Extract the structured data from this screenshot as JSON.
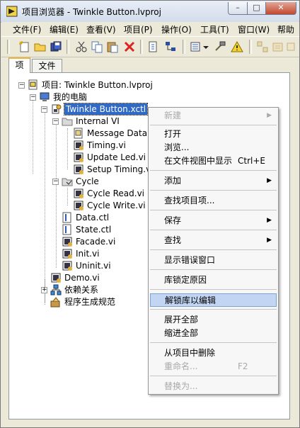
{
  "window": {
    "title": "项目浏览器 - Twinkle Button.lvproj",
    "controls": {
      "minimize": "–",
      "maximize": "□",
      "close": "✕"
    }
  },
  "menubar": {
    "items": [
      "文件(F)",
      "编辑(E)",
      "查看(V)",
      "项目(P)",
      "操作(O)",
      "工具(T)",
      "窗口(W)",
      "帮助"
    ]
  },
  "tabs": {
    "items": "项",
    "files": "文件"
  },
  "tree": {
    "project": "项目: Twinkle Button.lvproj",
    "my_computer": "我的电脑",
    "xctl": "Twinkle Button.xctl",
    "internal_vi": "Internal VI",
    "message_data": "Message Data.ctl",
    "timing": "Timing.vi",
    "update_led": "Update Led.vi",
    "setup_timing": "Setup Timing.vi",
    "cycle": "Cycle",
    "cycle_read": "Cycle Read.vi",
    "cycle_write": "Cycle Write.vi",
    "data_ctl": "Data.ctl",
    "state_ctl": "State.ctl",
    "facade": "Facade.vi",
    "init": "Init.vi",
    "uninit": "Uninit.vi",
    "demo": "Demo.vi",
    "dependencies": "依赖关系",
    "build_specs": "程序生成规范"
  },
  "context_menu": {
    "new": "新建",
    "open": "打开",
    "browse": "浏览...",
    "show_in_files": "在文件视图中显示",
    "show_in_files_shortcut": "Ctrl+E",
    "add": "添加",
    "find_project_items": "查找项目项...",
    "save": "保存",
    "find": "查找",
    "show_error": "显示错误窗口",
    "lock_reason": "库锁定原因",
    "unlock_to_edit": "解锁库以编辑",
    "expand_all": "展开全部",
    "collapse_all": "缩进全部",
    "remove_from_project": "从项目中删除",
    "rename": "重命名...",
    "rename_shortcut": "F2",
    "replace_with": "替换为..."
  },
  "colors": {
    "selection": "#316ac5",
    "menu_highlight": "#c2d5f2"
  }
}
